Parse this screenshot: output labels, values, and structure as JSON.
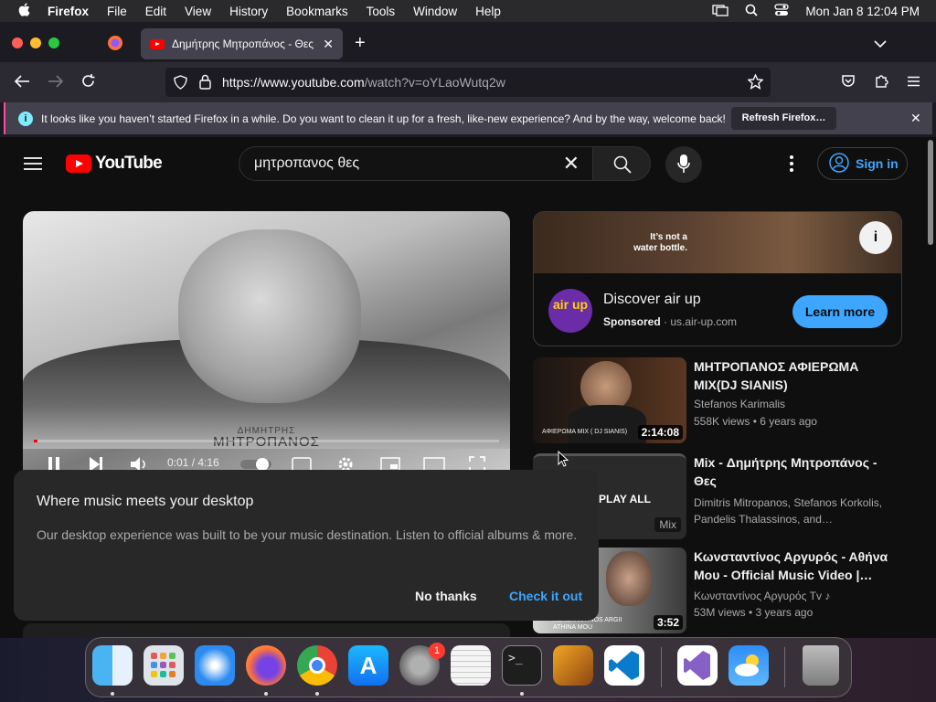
{
  "menubar": {
    "app": "Firefox",
    "items": [
      "File",
      "Edit",
      "View",
      "History",
      "Bookmarks",
      "Tools",
      "Window",
      "Help"
    ],
    "datetime": "Mon Jan 8  12:04 PM"
  },
  "tab": {
    "title": "Δημήτρης Μητροπάνος - Θες -"
  },
  "urlbar": {
    "host": "https://www.youtube.com",
    "path": "/watch?v=oYLaoWutq2w"
  },
  "notification": {
    "text": "It looks like you haven’t started Firefox in a while. Do you want to clean it up for a fresh, like-new experience? And by the way, welcome back!",
    "button": "Refresh Firefox…"
  },
  "youtube": {
    "logo": "YouTube",
    "search_value": "μητροπανος θες",
    "signin": "Sign in"
  },
  "player": {
    "caption_small": "ΔΗΜΗΤΡΗΣ",
    "caption_big": "ΜΗΤΡΟΠΑΝΟΣ",
    "time": "0:01 / 4:16",
    "progress": 0.004
  },
  "ad": {
    "tagline": "It’s not a water bottle.",
    "logo": "air up",
    "name": "Discover air up",
    "sponsored": "Sponsored",
    "domain": "us.air-up.com",
    "cta": "Learn more"
  },
  "recommendations": [
    {
      "title": "ΜΗΤΡΟΠΑΝΟΣ ΑΦΙΕΡΩΜΑ MIX(DJ SIANIS)",
      "channel": "Stefanos Karimalis",
      "meta": "558K views  •  6 years ago",
      "duration": "2:14:08",
      "thumb_text": "ΑΦΙΕΡΩΜΑ MIX ( DJ SIANIS)"
    },
    {
      "title": "Mix - Δημήτρης Μητροπάνος - Θες",
      "channel": "Dimitris Mitropanos, Stefanos Korkolis, Pandelis Thalassinos, and…",
      "meta": "",
      "duration": "",
      "thumb_text": "PLAY ALL",
      "badge": "Mix"
    },
    {
      "title": "Κωνσταντίνος Αργυρός - Αθήνα Μου - Official Music Video |…",
      "channel": "Κωνσταντίνος Αργυρός Tv ♪",
      "meta": "53M views  •  3 years ago",
      "duration": "3:52",
      "thumb_text": "KONSTANTINOS ARGII ATHINA MOU"
    }
  ],
  "promo": {
    "heading": "Where music meets your desktop",
    "body": "Our desktop experience was built to be your music destination. Listen to official albums & more.",
    "dismiss": "No thanks",
    "accept": "Check it out"
  },
  "dock": {
    "apps": [
      "finder-icon",
      "launchpad-icon",
      "safari-icon",
      "firefox-icon",
      "chrome-icon",
      "app-store-icon",
      "system-settings-icon",
      "textedit-icon",
      "terminal-icon",
      "garageband-icon",
      "vscode-icon",
      "visual-studio-icon",
      "weather-icon",
      "trash-icon"
    ],
    "settings_badge": "1"
  },
  "colors": {
    "youtube_red": "#ff0000",
    "link_blue": "#3ea6ff",
    "firefox_dark": "#1c1b22"
  }
}
